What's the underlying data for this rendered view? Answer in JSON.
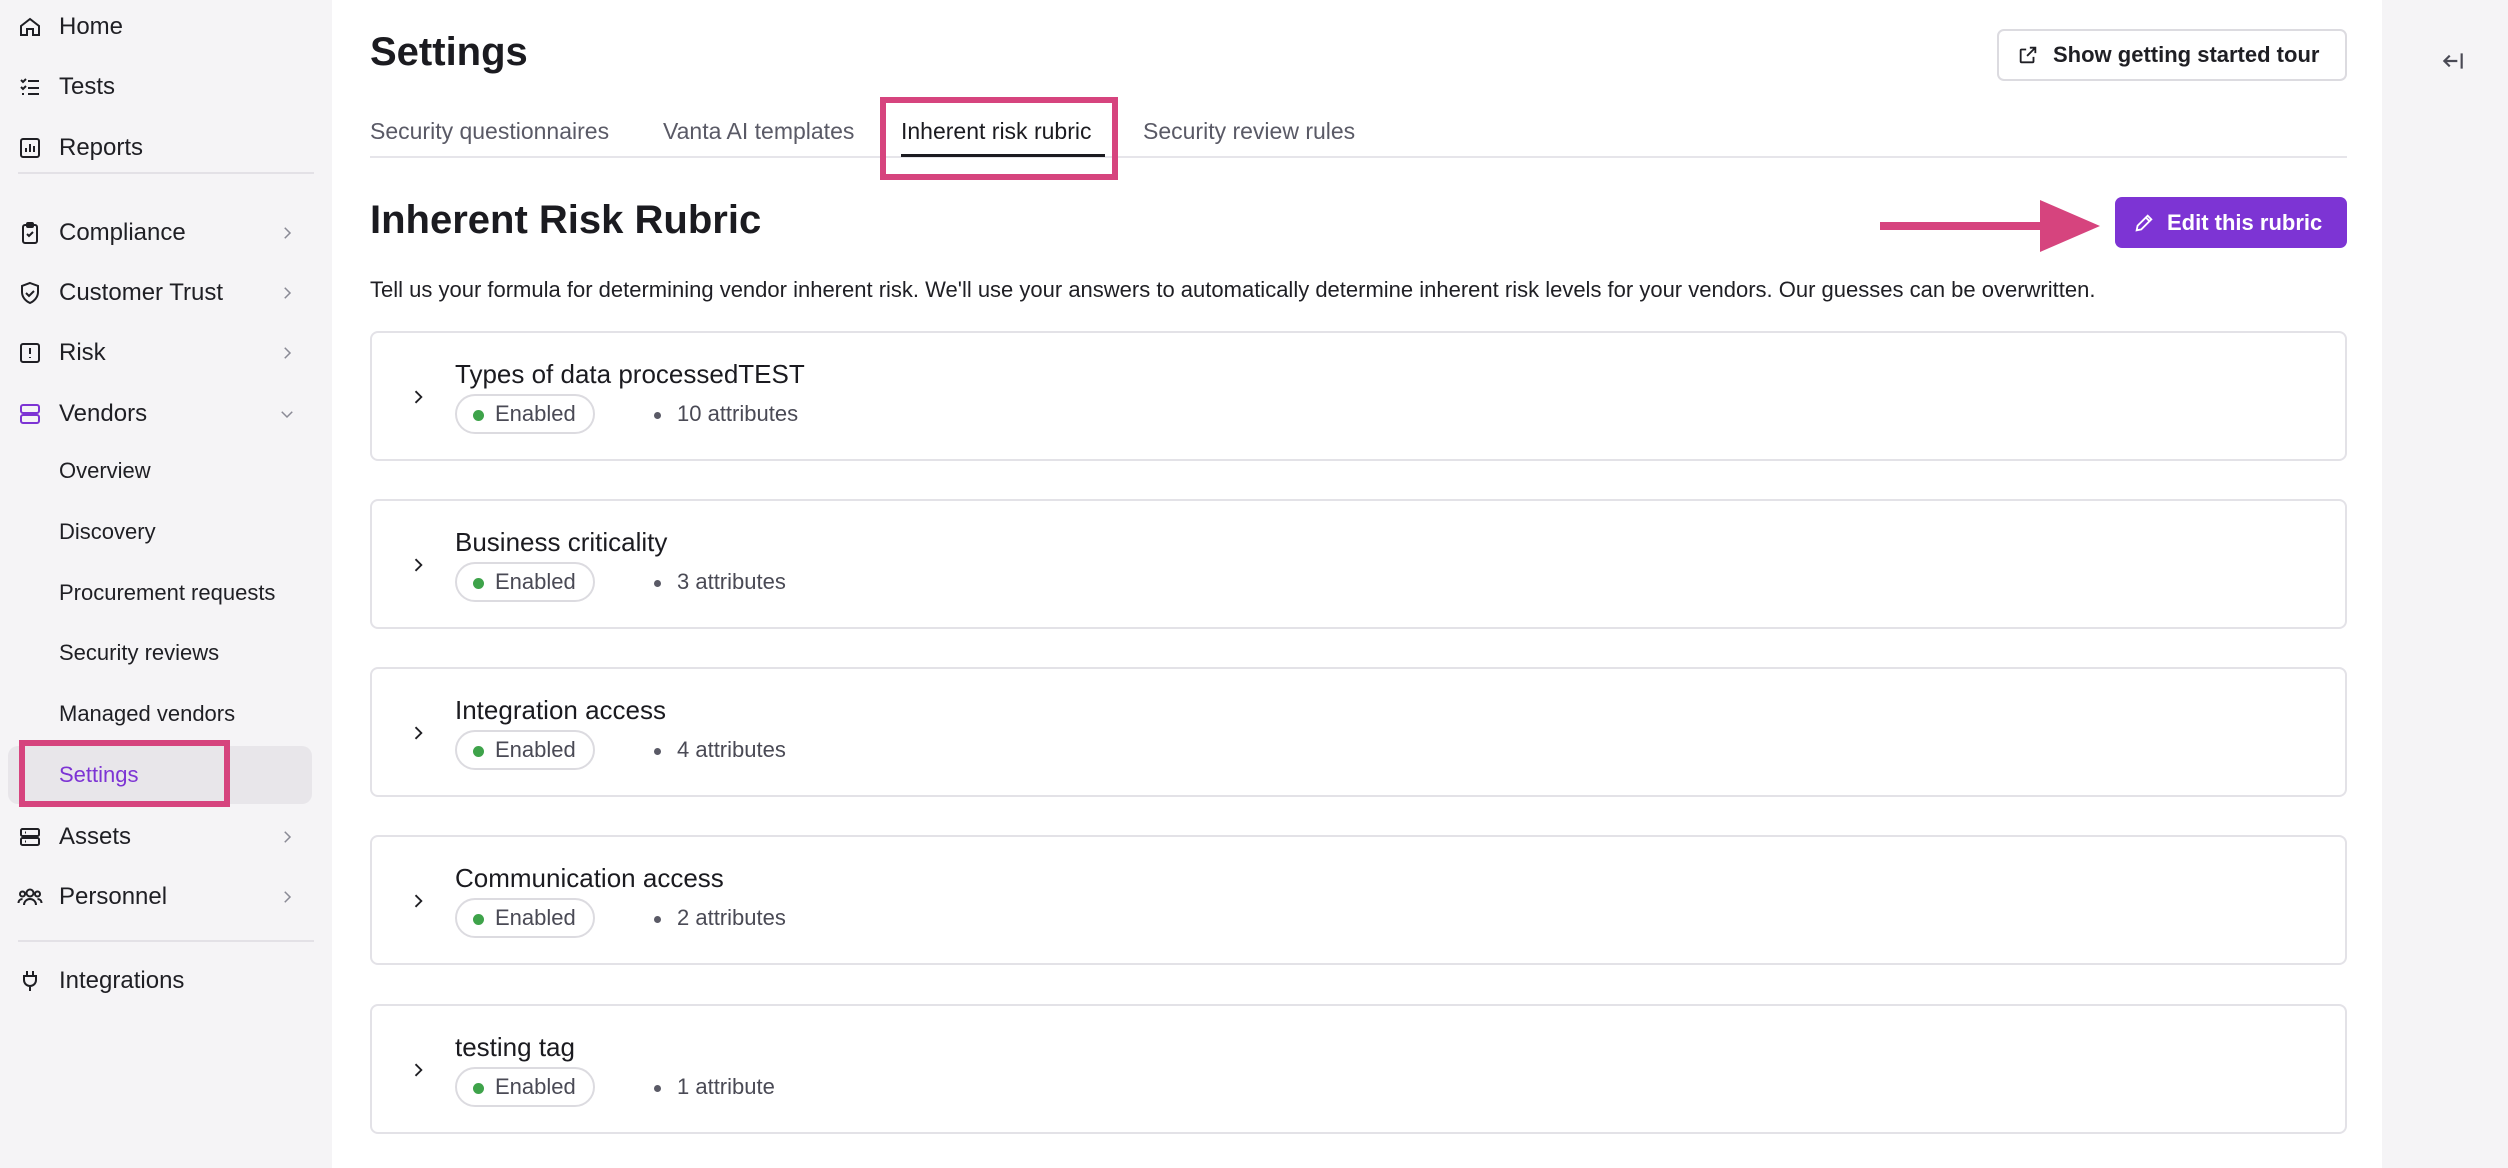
{
  "sidebar": {
    "items": [
      {
        "label": "Home",
        "icon": "home-icon"
      },
      {
        "label": "Tests",
        "icon": "list-check-icon"
      },
      {
        "label": "Reports",
        "icon": "bar-chart-icon"
      },
      {
        "label": "Compliance",
        "icon": "clipboard-check-icon"
      },
      {
        "label": "Customer Trust",
        "icon": "shield-check-icon"
      },
      {
        "label": "Risk",
        "icon": "alert-square-icon"
      },
      {
        "label": "Vendors",
        "icon": "vendors-icon"
      },
      {
        "label": "Assets",
        "icon": "server-icon"
      },
      {
        "label": "Personnel",
        "icon": "people-icon"
      },
      {
        "label": "Integrations",
        "icon": "plug-icon"
      }
    ],
    "vendors_sub": [
      {
        "label": "Overview"
      },
      {
        "label": "Discovery"
      },
      {
        "label": "Procurement requests"
      },
      {
        "label": "Security reviews"
      },
      {
        "label": "Managed vendors"
      },
      {
        "label": "Settings",
        "active": true
      }
    ]
  },
  "header": {
    "title": "Settings",
    "tour_button": "Show getting started tour"
  },
  "tabs": [
    {
      "label": "Security questionnaires"
    },
    {
      "label": "Vanta AI templates"
    },
    {
      "label": "Inherent risk rubric",
      "active": true
    },
    {
      "label": "Security review rules"
    }
  ],
  "rubric": {
    "title": "Inherent Risk Rubric",
    "edit_button": "Edit this rubric",
    "description": "Tell us your formula for determining vendor inherent risk. We'll use your answers to automatically determine inherent risk levels for your vendors. Our guesses can be overwritten.",
    "cards": [
      {
        "title": "Types of data processedTEST",
        "status": "Enabled",
        "attributes": "10 attributes"
      },
      {
        "title": "Business criticality",
        "status": "Enabled",
        "attributes": "3 attributes"
      },
      {
        "title": "Integration access",
        "status": "Enabled",
        "attributes": "4 attributes"
      },
      {
        "title": "Communication access",
        "status": "Enabled",
        "attributes": "2 attributes"
      },
      {
        "title": "testing tag",
        "status": "Enabled",
        "attributes": "1 attribute"
      }
    ]
  },
  "colors": {
    "accent": "#7d34d4",
    "highlight": "#d6447e",
    "enabled_dot": "#3ea34a"
  }
}
